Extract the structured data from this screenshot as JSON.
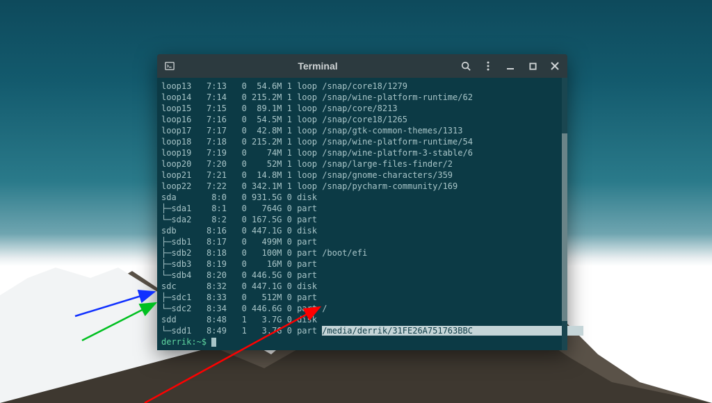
{
  "window": {
    "title": "Terminal"
  },
  "rows": [
    {
      "name": "loop13",
      "mm": "7:13",
      "rm": "0",
      "size": "54.6M",
      "ro": "1",
      "type": "loop",
      "mount": "/snap/core18/1279",
      "tree": false
    },
    {
      "name": "loop14",
      "mm": "7:14",
      "rm": "0",
      "size": "215.2M",
      "ro": "1",
      "type": "loop",
      "mount": "/snap/wine-platform-runtime/62",
      "tree": false
    },
    {
      "name": "loop15",
      "mm": "7:15",
      "rm": "0",
      "size": "89.1M",
      "ro": "1",
      "type": "loop",
      "mount": "/snap/core/8213",
      "tree": false
    },
    {
      "name": "loop16",
      "mm": "7:16",
      "rm": "0",
      "size": "54.5M",
      "ro": "1",
      "type": "loop",
      "mount": "/snap/core18/1265",
      "tree": false
    },
    {
      "name": "loop17",
      "mm": "7:17",
      "rm": "0",
      "size": "42.8M",
      "ro": "1",
      "type": "loop",
      "mount": "/snap/gtk-common-themes/1313",
      "tree": false
    },
    {
      "name": "loop18",
      "mm": "7:18",
      "rm": "0",
      "size": "215.2M",
      "ro": "1",
      "type": "loop",
      "mount": "/snap/wine-platform-runtime/54",
      "tree": false
    },
    {
      "name": "loop19",
      "mm": "7:19",
      "rm": "0",
      "size": "74M",
      "ro": "1",
      "type": "loop",
      "mount": "/snap/wine-platform-3-stable/6",
      "tree": false
    },
    {
      "name": "loop20",
      "mm": "7:20",
      "rm": "0",
      "size": "52M",
      "ro": "1",
      "type": "loop",
      "mount": "/snap/large-files-finder/2",
      "tree": false
    },
    {
      "name": "loop21",
      "mm": "7:21",
      "rm": "0",
      "size": "14.8M",
      "ro": "1",
      "type": "loop",
      "mount": "/snap/gnome-characters/359",
      "tree": false
    },
    {
      "name": "loop22",
      "mm": "7:22",
      "rm": "0",
      "size": "342.1M",
      "ro": "1",
      "type": "loop",
      "mount": "/snap/pycharm-community/169",
      "tree": false
    },
    {
      "name": "sda",
      "mm": "8:0",
      "rm": "0",
      "size": "931.5G",
      "ro": "0",
      "type": "disk",
      "mount": "",
      "tree": false
    },
    {
      "name": "sda1",
      "mm": "8:1",
      "rm": "0",
      "size": "764G",
      "ro": "0",
      "type": "part",
      "mount": "",
      "tree": "mid"
    },
    {
      "name": "sda2",
      "mm": "8:2",
      "rm": "0",
      "size": "167.5G",
      "ro": "0",
      "type": "part",
      "mount": "",
      "tree": "end"
    },
    {
      "name": "sdb",
      "mm": "8:16",
      "rm": "0",
      "size": "447.1G",
      "ro": "0",
      "type": "disk",
      "mount": "",
      "tree": false
    },
    {
      "name": "sdb1",
      "mm": "8:17",
      "rm": "0",
      "size": "499M",
      "ro": "0",
      "type": "part",
      "mount": "",
      "tree": "mid"
    },
    {
      "name": "sdb2",
      "mm": "8:18",
      "rm": "0",
      "size": "100M",
      "ro": "0",
      "type": "part",
      "mount": "/boot/efi",
      "tree": "mid"
    },
    {
      "name": "sdb3",
      "mm": "8:19",
      "rm": "0",
      "size": "16M",
      "ro": "0",
      "type": "part",
      "mount": "",
      "tree": "mid"
    },
    {
      "name": "sdb4",
      "mm": "8:20",
      "rm": "0",
      "size": "446.5G",
      "ro": "0",
      "type": "part",
      "mount": "",
      "tree": "end"
    },
    {
      "name": "sdc",
      "mm": "8:32",
      "rm": "0",
      "size": "447.1G",
      "ro": "0",
      "type": "disk",
      "mount": "",
      "tree": false
    },
    {
      "name": "sdc1",
      "mm": "8:33",
      "rm": "0",
      "size": "512M",
      "ro": "0",
      "type": "part",
      "mount": "",
      "tree": "mid"
    },
    {
      "name": "sdc2",
      "mm": "8:34",
      "rm": "0",
      "size": "446.6G",
      "ro": "0",
      "type": "part",
      "mount": "/",
      "tree": "end"
    },
    {
      "name": "sdd",
      "mm": "8:48",
      "rm": "1",
      "size": "3.7G",
      "ro": "0",
      "type": "disk",
      "mount": "",
      "tree": false
    },
    {
      "name": "sdd1",
      "mm": "8:49",
      "rm": "1",
      "size": "3.7G",
      "ro": "0",
      "type": "part",
      "mount": "/media/derrik/31FE26A751763BBC",
      "tree": "end",
      "highlightMount": true
    }
  ],
  "prompt": {
    "user_host": "derrik",
    "path": "~",
    "suffix": "$"
  }
}
